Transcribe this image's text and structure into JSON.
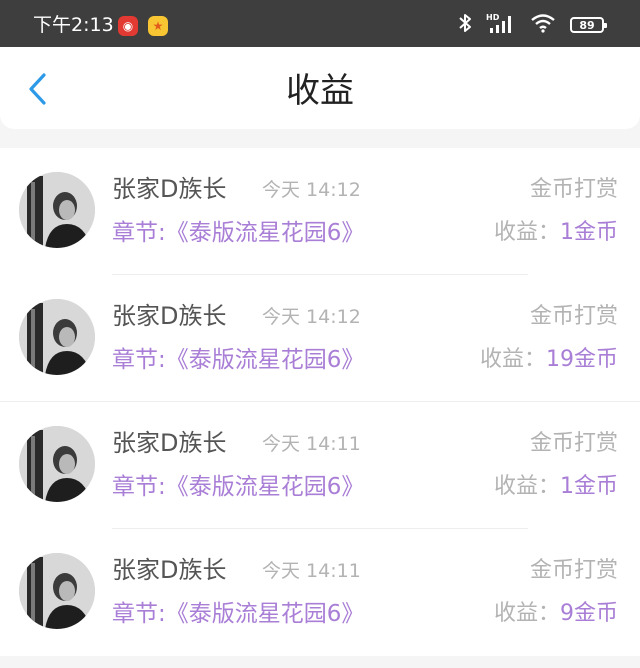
{
  "status_bar": {
    "time": "下午2:13",
    "battery": "89",
    "apps": [
      "netease-music-icon",
      "game-center-icon"
    ],
    "signal_label": "HD"
  },
  "header": {
    "title": "收益"
  },
  "records": [
    {
      "name": "张家D族长",
      "time": "今天 14:12",
      "type": "金币打赏",
      "chapter": "章节:《泰版流星花园6》",
      "earn_label": "收益：",
      "earn_value": "1金币"
    },
    {
      "name": "张家D族长",
      "time": "今天 14:12",
      "type": "金币打赏",
      "chapter": "章节:《泰版流星花园6》",
      "earn_label": "收益：",
      "earn_value": "19金币"
    },
    {
      "name": "张家D族长",
      "time": "今天 14:11",
      "type": "金币打赏",
      "chapter": "章节:《泰版流星花园6》",
      "earn_label": "收益：",
      "earn_value": "1金币"
    },
    {
      "name": "张家D族长",
      "time": "今天 14:11",
      "type": "金币打赏",
      "chapter": "章节:《泰版流星花园6》",
      "earn_label": "收益：",
      "earn_value": "9金币"
    }
  ],
  "colors": {
    "accent_purple": "#a97ed6",
    "back_blue": "#2d9ae8",
    "status_bar_bg": "#3e3e3e"
  }
}
